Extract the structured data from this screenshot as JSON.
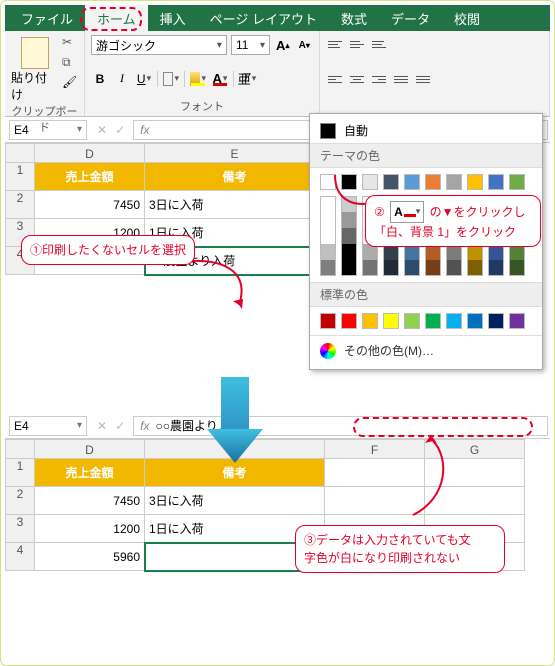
{
  "tabs": {
    "file": "ファイル",
    "home": "ホーム",
    "insert": "挿入",
    "layout": "ページ レイアウト",
    "formula": "数式",
    "data": "データ",
    "review": "校閲"
  },
  "ribbon": {
    "paste": "貼り付け",
    "clipboard_cap": "クリップボード",
    "font_name": "游ゴシック",
    "font_size": "11",
    "font_cap": "フォント",
    "bold": "B",
    "ital": "I",
    "ul": "U",
    "A": "A"
  },
  "top": {
    "name": "E4",
    "fx": "fx",
    "fval": "",
    "cols": {
      "D": "D",
      "E": "E"
    },
    "headers": {
      "D": "売上金額",
      "E": "備考"
    },
    "rows": [
      {
        "r": "1"
      },
      {
        "r": "2",
        "D": "7450",
        "E": "3日に入荷"
      },
      {
        "r": "3",
        "D": "1200",
        "E": "1日に入荷"
      },
      {
        "r": "4",
        "D": "5960",
        "E": "○○農園より入荷"
      }
    ]
  },
  "picker": {
    "auto": "自動",
    "theme": "テーマの色",
    "standard": "標準の色",
    "more": "その他の色(M)…",
    "theme_colors": [
      "#ffffff",
      "#000000",
      "#e7e6e6",
      "#44546a",
      "#5b9bd5",
      "#ed7d31",
      "#a5a5a5",
      "#ffc000",
      "#4472c4",
      "#70ad47"
    ],
    "standard_colors": [
      "#c00000",
      "#ff0000",
      "#ffc000",
      "#ffff00",
      "#92d050",
      "#00b050",
      "#00b0f0",
      "#0070c0",
      "#002060",
      "#7030a0"
    ]
  },
  "anno": {
    "one": "①印刷したくないセルを選択",
    "two_a": "②",
    "two_b": "の▼をクリックし",
    "two_c": "「白、背景 1」をクリック",
    "three_a": "③データは入力されていても文",
    "three_b": "字色が白になり印刷されない"
  },
  "bottom": {
    "name": "E4",
    "fx": "fx",
    "fval": "○○農園より入荷",
    "cols": {
      "D": "D",
      "E": "E",
      "F": "F",
      "G": "G"
    },
    "headers": {
      "D": "売上金額",
      "E": "備考"
    },
    "rows": [
      {
        "r": "1"
      },
      {
        "r": "2",
        "D": "7450",
        "E": "3日に入荷"
      },
      {
        "r": "3",
        "D": "1200",
        "E": "1日に入荷"
      },
      {
        "r": "4",
        "D": "5960",
        "E": ""
      }
    ]
  }
}
